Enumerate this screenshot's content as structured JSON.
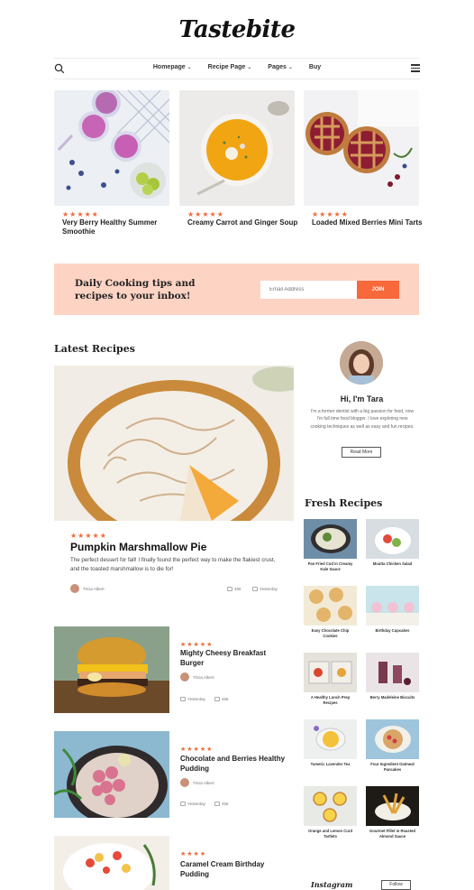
{
  "site": {
    "logo": "Tastebite"
  },
  "nav": {
    "items": [
      {
        "label": "Homepage",
        "has_dropdown": true
      },
      {
        "label": "Recipe Page",
        "has_dropdown": true
      },
      {
        "label": "Pages",
        "has_dropdown": true
      },
      {
        "label": "Buy",
        "has_dropdown": false
      }
    ],
    "icons": {
      "search": "search-icon",
      "menu": "hamburger-menu-icon"
    }
  },
  "featured": [
    {
      "stars": "★★★★★",
      "title": "Very Berry Healthy Summer Smoothie"
    },
    {
      "stars": "★★★★★",
      "title": "Creamy Carrot and Ginger Soup"
    },
    {
      "stars": "★★★★★",
      "title": "Loaded Mixed Berries Mini Tarts"
    }
  ],
  "newsletter": {
    "heading": "Daily Cooking tips and recipes to your inbox!",
    "placeholder": "Email Address",
    "button": "JOIN"
  },
  "latest": {
    "title": "Latest Recipes",
    "hero": {
      "stars": "★★★★★",
      "title": "Pumpkin Marshmallow Pie",
      "description": "The perfect dessert for fall! I finally found the perfect way to make the flakiest crust, and the toasted marshmallow is to die for!",
      "author": "Tricia Albert",
      "comments": "456",
      "date": "Yesterday"
    },
    "list": [
      {
        "stars": "★★★★★",
        "title": "Mighty Cheesy Breakfast Burger",
        "author": "Tricia Albert",
        "date": "Yesterday",
        "comments": "456"
      },
      {
        "stars": "★★★★★",
        "title": "Chocolate and Berries Healthy Pudding",
        "author": "Tricia Albert",
        "date": "Yesterday",
        "comments": "456"
      },
      {
        "stars": "★★★★",
        "title": "Caramel Cream Birthday Pudding"
      }
    ]
  },
  "about": {
    "title": "Hi, I'm Tara",
    "text": "I'm a former dentist with a big passion for food, now I'm full time food blogger. I love exploring new cooking techniques as well as easy and fun recipes.",
    "button": "Read More"
  },
  "fresh": {
    "title": "Fresh Recipes",
    "items": [
      {
        "label": "Pan Fried Cod in Creamy Kale Sauce"
      },
      {
        "label": "Moutta Chicken Salad"
      },
      {
        "label": "Easy Chocolate Chip Cookies"
      },
      {
        "label": "Birthday Cupcakes"
      },
      {
        "label": "A Healthy Lunch Prep Recipes"
      },
      {
        "label": "Berry Madeleine Biscuits"
      },
      {
        "label": "Tumeric Lavender Tea"
      },
      {
        "label": "Four Ingredient Oatmeal Pancakes"
      },
      {
        "label": "Orange and Lemon Curd Tartlets"
      },
      {
        "label": "Gourmet Fillet in Roasted Almond Sauce"
      }
    ]
  },
  "instagram": {
    "title": "Instagram",
    "follow": "Follow"
  },
  "colors": {
    "accent": "#f7683a",
    "stars": "#f06a3b",
    "newsletter_bg": "#fdd3c4"
  }
}
